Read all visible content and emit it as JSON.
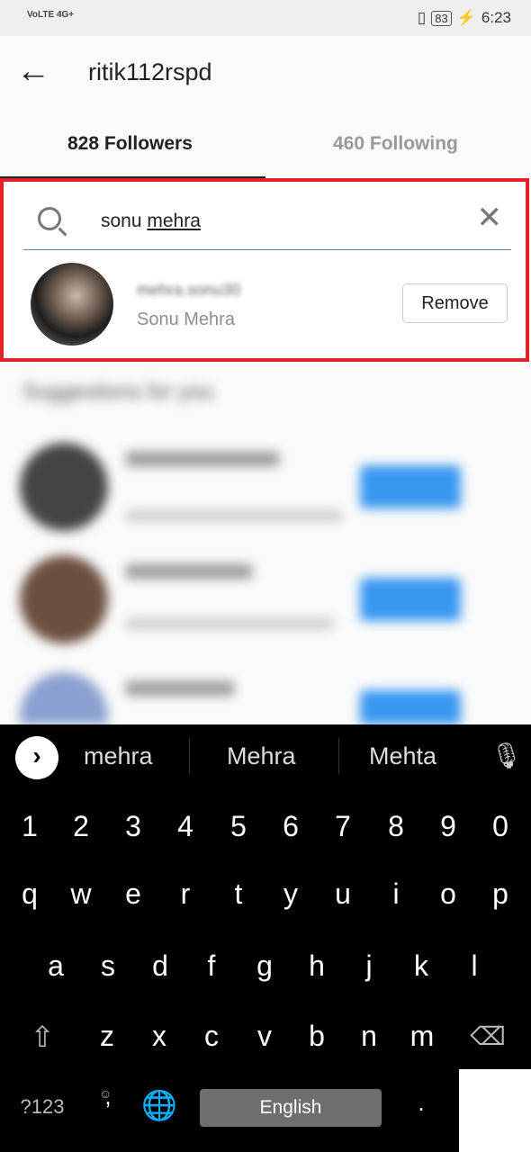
{
  "status_bar": {
    "network": "VoLTE 4G+",
    "battery": "83",
    "time": "6:23"
  },
  "header": {
    "title": "ritik112rspd"
  },
  "tabs": [
    {
      "label": "828 Followers",
      "active": true
    },
    {
      "label": "460 Following",
      "active": false
    }
  ],
  "search": {
    "value_prefix": "sonu ",
    "value_underlined": "mehra"
  },
  "result": {
    "username": "mehra.sonu30",
    "full_name": "Sonu Mehra",
    "action": "Remove"
  },
  "background": {
    "section_title": "Suggestions for you"
  },
  "keyboard": {
    "suggestions": [
      "mehra",
      "Mehra",
      "Mehta"
    ],
    "rows": [
      [
        "1",
        "2",
        "3",
        "4",
        "5",
        "6",
        "7",
        "8",
        "9",
        "0"
      ],
      [
        "q",
        "w",
        "e",
        "r",
        "t",
        "y",
        "u",
        "i",
        "o",
        "p"
      ],
      [
        "a",
        "s",
        "d",
        "f",
        "g",
        "h",
        "j",
        "k",
        "l"
      ],
      [
        "z",
        "x",
        "c",
        "v",
        "b",
        "n",
        "m"
      ]
    ],
    "symbols": "?123",
    "comma": ",",
    "period": ".",
    "space": "English"
  },
  "colors": {
    "highlight": "#e3202b",
    "follow_blue": "#3897f0"
  }
}
